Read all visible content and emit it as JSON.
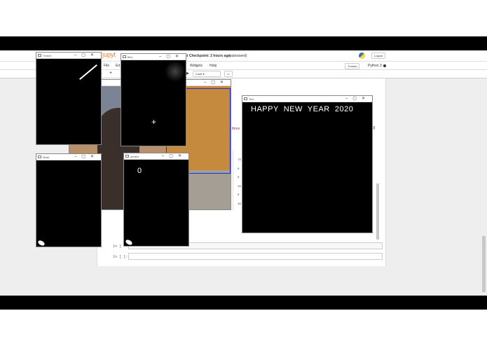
{
  "notebook": {
    "logo_text": "jupyt",
    "checkpoint": "st Checkpoint: 2 hours ago",
    "autosaved": "(autosaved)",
    "logout": "Logout",
    "menu": {
      "file": "File",
      "edit": "Ed",
      "widgets": "Widgets",
      "help": "Help"
    },
    "trusted": "Trusted",
    "kernel": "Python 3",
    "cell_type": "Code",
    "code_snippet": "thres",
    "code_tail": "0)",
    "prompts": [
      "In [",
      "In [ ]:"
    ],
    "table_values": [
      "73",
      "0",
      "0",
      "18",
      "0",
      "16"
    ]
  },
  "windows": {
    "frame": {
      "title": "Frame"
    },
    "blur": {
      "title": "Blur"
    },
    "thresh": {
      "title": "Thresh"
    },
    "mask": {
      "title": "Mask"
    },
    "predict": {
      "title": "predict",
      "value": "0"
    },
    "text": {
      "title": "Text",
      "message": "HAPPY  NEW  YEAR  2020"
    }
  }
}
